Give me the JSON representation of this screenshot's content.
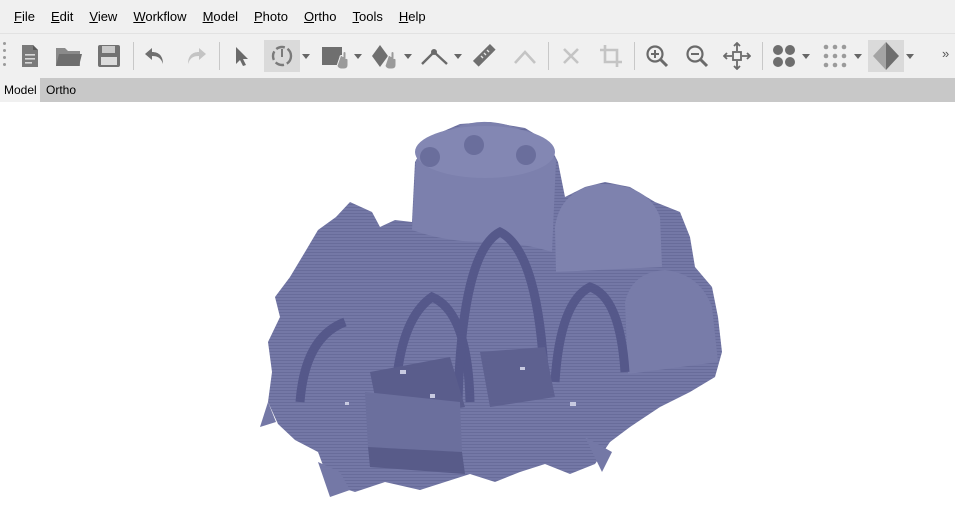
{
  "menu": [
    {
      "mnemonic": "F",
      "rest": "ile"
    },
    {
      "mnemonic": "E",
      "rest": "dit"
    },
    {
      "mnemonic": "V",
      "rest": "iew"
    },
    {
      "mnemonic": "W",
      "rest": "orkflow"
    },
    {
      "mnemonic": "M",
      "rest": "odel"
    },
    {
      "mnemonic": "P",
      "rest": "hoto"
    },
    {
      "mnemonic": "O",
      "rest": "rtho"
    },
    {
      "mnemonic": "T",
      "rest": "ools"
    },
    {
      "mnemonic": "H",
      "rest": "elp"
    }
  ],
  "toolbar": {
    "overflow": "»",
    "icons": [
      "new-document-icon",
      "open-folder-icon",
      "save-icon",
      "undo-icon",
      "redo-icon",
      "select-pointer-icon",
      "rotate-object-icon",
      "rectangle-selection-icon",
      "shape-selection-icon",
      "ruler-line-icon",
      "ruler-icon",
      "draw-polyline-icon",
      "delete-icon",
      "crop-icon",
      "zoom-in-icon",
      "zoom-out-icon",
      "reset-view-icon",
      "point-cloud-icon",
      "dense-cloud-icon",
      "model-shaded-icon"
    ]
  },
  "tabs": [
    {
      "label": "Model",
      "active": true
    },
    {
      "label": "Ortho",
      "active": false
    }
  ],
  "colors": {
    "chrome": "#f0f0f0",
    "tabbar": "#c8c8c8",
    "model": "#7478a6",
    "model_dark": "#4e5180",
    "icon": "#6b6b6b"
  }
}
